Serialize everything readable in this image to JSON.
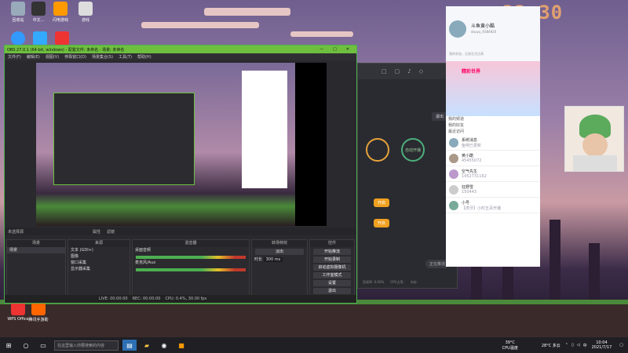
{
  "desktop": {
    "icons": [
      {
        "label": "回收站",
        "color": "#9ab"
      },
      {
        "label": "中文...",
        "color": "#333"
      },
      {
        "label": "闪电游戏",
        "color": "#f90"
      },
      {
        "label": "游戏",
        "color": "#ddd"
      },
      {
        "label": "",
        "color": "#39f"
      },
      {
        "label": "",
        "color": "#3af"
      },
      {
        "label": "",
        "color": "#e33"
      },
      {
        "label": "WPS Office",
        "color": "#e33"
      },
      {
        "label": "腾讯手游助",
        "color": "#f60"
      }
    ],
    "clock_display": "22:30"
  },
  "obs": {
    "title": "OBS 27.0.1 (64-bit, windows) - 配置文件: 未命名 - 场景: 未命名",
    "menu": [
      "文件(F)",
      "编辑(E)",
      "视图(V)",
      "停靠窗口(D)",
      "场景集合(S)",
      "工具(T)",
      "帮助(H)"
    ],
    "panels": {
      "scenes": {
        "title": "场景",
        "items": [
          "场景"
        ]
      },
      "sources": {
        "title": "来源",
        "items": [
          "文本 (GDI+)",
          "图像",
          "窗口采集",
          "显示器采集"
        ]
      },
      "mixer": {
        "title": "混音器",
        "tracks": [
          {
            "name": "桌面音频",
            "level": "0.0 dB"
          },
          {
            "name": "麦克风/Aux",
            "level": "0.0 dB"
          }
        ]
      },
      "transitions": {
        "title": "转场特效",
        "type": "淡出",
        "duration_label": "时长",
        "duration": "300 ms"
      },
      "controls": {
        "title": "控件",
        "buttons": [
          "开始推流",
          "开始录制",
          "启动虚拟摄像机",
          "工作室模式",
          "设置",
          "退出"
        ]
      }
    },
    "tabs": {
      "properties": "属性",
      "filters": "滤镜"
    },
    "no_source": "未选择源",
    "status": {
      "live": "LIVE: 00:00:00",
      "rec": "REC: 00:00:00",
      "cpu": "CPU: 0.4%, 30.00 fps"
    }
  },
  "streamer_tool": {
    "exit_label": "退出",
    "scene_a": "添加画面",
    "scene_b": "自动开播",
    "volume_label": "声卡",
    "mic_label": "麦克风",
    "button_on": "开启",
    "stop_label": "正在推流",
    "footer": [
      "丢帧率: 0.00%",
      "CPU占用:",
      "内存:"
    ]
  },
  "chat_app": {
    "username": "斗鱼黄小酷",
    "user_id": "douyu_9384920",
    "status_text": "我的状态，记录生活点滴",
    "banner": "精彩世界",
    "sections": [
      "我的频道",
      "我的好友",
      "最近访问"
    ],
    "contacts": [
      {
        "name": "系统消息",
        "msg": "鱼吧已更新"
      },
      {
        "name": "黄小酷",
        "msg": "45455072"
      },
      {
        "name": "空气先生",
        "msg": "1452731162"
      },
      {
        "name": "狂野雪",
        "msg": "150443"
      },
      {
        "name": "小号",
        "msg": "【虎牙】小时五百开播"
      }
    ]
  },
  "taskbar": {
    "search_placeholder": "在这里输入你要搜索的内容",
    "weather": "28°C 多云",
    "cpu_temp": "39°C",
    "cpu_temp_label": "CPU温度",
    "time": "10:04",
    "date": "2021/7/17",
    "lang": "中"
  }
}
